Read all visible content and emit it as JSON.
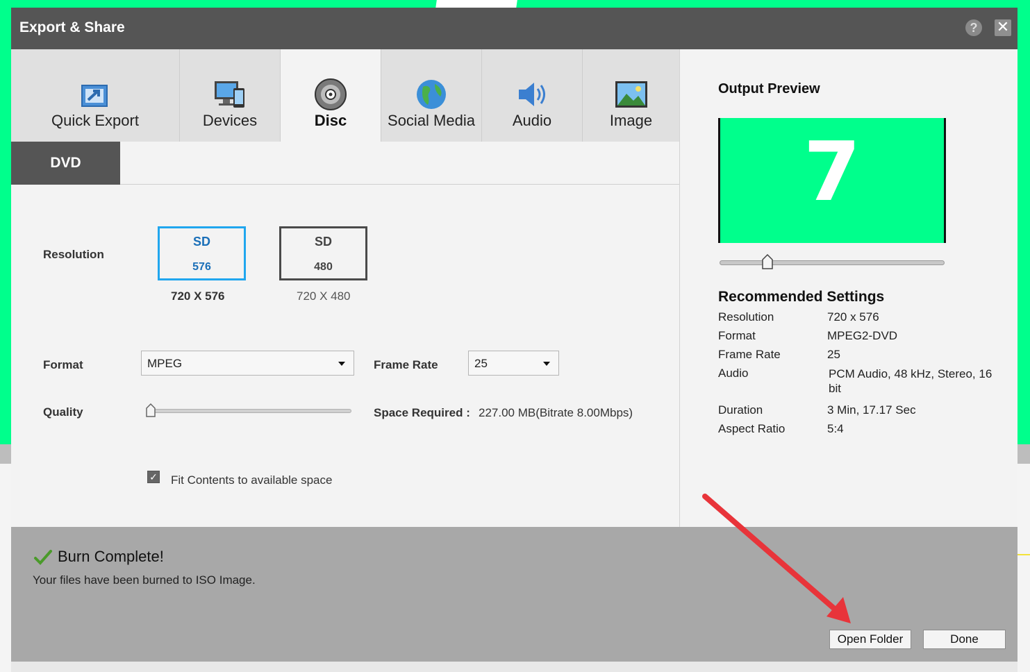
{
  "window": {
    "title": "Export & Share"
  },
  "tabs": [
    {
      "label": "Quick Export"
    },
    {
      "label": "Devices"
    },
    {
      "label": "Disc"
    },
    {
      "label": "Social Media"
    },
    {
      "label": "Audio"
    },
    {
      "label": "Image"
    }
  ],
  "subtab": {
    "label": "DVD"
  },
  "resolution": {
    "label": "Resolution",
    "options": [
      {
        "top": "SD",
        "bottom": "576",
        "dims": "720 X 576"
      },
      {
        "top": "SD",
        "bottom": "480",
        "dims": "720 X 480"
      }
    ]
  },
  "format": {
    "label": "Format",
    "value": "MPEG"
  },
  "frame_rate": {
    "label": "Frame Rate",
    "value": "25"
  },
  "quality": {
    "label": "Quality",
    "level_percent": 0
  },
  "space": {
    "label": "Space Required :",
    "value": "227.00 MB(Bitrate 8.00Mbps)"
  },
  "fit": {
    "label": "Fit Contents to available space",
    "checked": true
  },
  "preview": {
    "title": "Output Preview",
    "frame_text": "7",
    "slider_percent": 21
  },
  "recommended": {
    "title": "Recommended Settings",
    "rows": [
      {
        "key": "Resolution",
        "value": "720 x 576"
      },
      {
        "key": "Format",
        "value": "MPEG2-DVD"
      },
      {
        "key": "Frame Rate",
        "value": "25"
      },
      {
        "key": "Audio",
        "value": "PCM Audio, 48 kHz, Stereo, 16 bit"
      },
      {
        "key": "Duration",
        "value": "3 Min, 17.17 Sec"
      },
      {
        "key": "Aspect Ratio",
        "value": "5:4"
      }
    ]
  },
  "status": {
    "title": "Burn Complete!",
    "message": "Your files have been burned to ISO Image."
  },
  "buttons": {
    "open_folder": "Open Folder",
    "done": "Done"
  },
  "colors": {
    "accent_blue": "#20a6ee",
    "titlebar": "#555555",
    "preview_green": "#00ff8c",
    "annotation_red": "#e8343a"
  }
}
